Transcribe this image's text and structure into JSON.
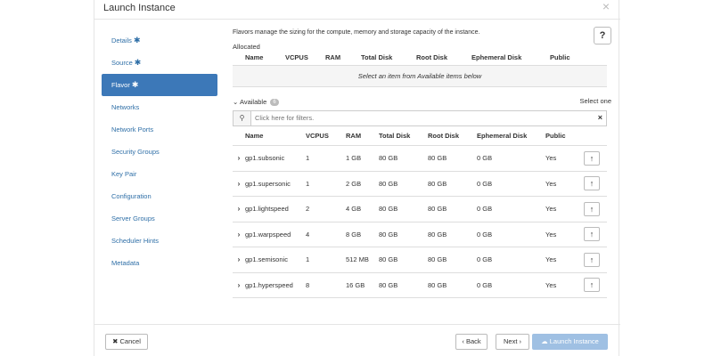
{
  "modal": {
    "title": "Launch Instance",
    "close": "×"
  },
  "sidebar": {
    "items": [
      {
        "label": "Details",
        "required": "✱"
      },
      {
        "label": "Source",
        "required": "✱"
      },
      {
        "label": "Flavor",
        "required": "✱"
      },
      {
        "label": "Networks"
      },
      {
        "label": "Network Ports"
      },
      {
        "label": "Security Groups"
      },
      {
        "label": "Key Pair"
      },
      {
        "label": "Configuration"
      },
      {
        "label": "Server Groups"
      },
      {
        "label": "Scheduler Hints"
      },
      {
        "label": "Metadata"
      }
    ]
  },
  "content": {
    "help": "?",
    "description": "Flavors manage the sizing for the compute, memory and storage capacity of the instance.",
    "allocated": {
      "label": "Allocated",
      "columns": [
        "Name",
        "VCPUS",
        "RAM",
        "Total Disk",
        "Root Disk",
        "Ephemeral Disk",
        "Public"
      ],
      "empty_message": "Select an item from Available items below"
    },
    "available": {
      "label": "Available",
      "count": "6",
      "select_one": "Select one",
      "filter_placeholder": "Click here for filters.",
      "columns": [
        "Name",
        "VCPUS",
        "RAM",
        "Total Disk",
        "Root Disk",
        "Ephemeral Disk",
        "Public"
      ],
      "rows": [
        {
          "name": "gp1.subsonic",
          "vcpus": "1",
          "ram": "1 GB",
          "total_disk": "80 GB",
          "root_disk": "80 GB",
          "ephemeral_disk": "0 GB",
          "public": "Yes"
        },
        {
          "name": "gp1.supersonic",
          "vcpus": "1",
          "ram": "2 GB",
          "total_disk": "80 GB",
          "root_disk": "80 GB",
          "ephemeral_disk": "0 GB",
          "public": "Yes"
        },
        {
          "name": "gp1.lightspeed",
          "vcpus": "2",
          "ram": "4 GB",
          "total_disk": "80 GB",
          "root_disk": "80 GB",
          "ephemeral_disk": "0 GB",
          "public": "Yes"
        },
        {
          "name": "gp1.warpspeed",
          "vcpus": "4",
          "ram": "8 GB",
          "total_disk": "80 GB",
          "root_disk": "80 GB",
          "ephemeral_disk": "0 GB",
          "public": "Yes"
        },
        {
          "name": "gp1.semisonic",
          "vcpus": "1",
          "ram": "512 MB",
          "total_disk": "80 GB",
          "root_disk": "80 GB",
          "ephemeral_disk": "0 GB",
          "public": "Yes"
        },
        {
          "name": "gp1.hyperspeed",
          "vcpus": "8",
          "ram": "16 GB",
          "total_disk": "80 GB",
          "root_disk": "80 GB",
          "ephemeral_disk": "0 GB",
          "public": "Yes"
        }
      ]
    }
  },
  "footer": {
    "cancel": "✖ Cancel",
    "back": "‹ Back",
    "next": "Next ›",
    "launch": "☁ Launch Instance"
  },
  "colors": {
    "accent": "#3c78b8",
    "link": "#2f6fa7",
    "launch_disabled": "#9fc0e3"
  }
}
